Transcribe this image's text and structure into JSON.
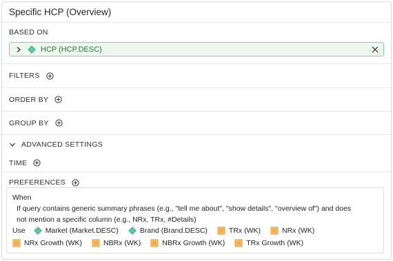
{
  "title": "Specific HCP (Overview)",
  "based_on": {
    "label": "BASED ON",
    "chip": "HCP (HCP.DESC)"
  },
  "sections": {
    "filters": "FILTERS",
    "order_by": "ORDER BY",
    "group_by": "GROUP BY",
    "advanced": "ADVANCED SETTINGS",
    "time": "TIME",
    "preferences": "PREFERENCES"
  },
  "rule": {
    "when": "When",
    "condition_line1": "If query contains generic summary phrases (e.g., \"tell me about\", \"show details\", \"overview of\") and does",
    "condition_line2": "not mention a specific column (e.g., NRx, TRx, #Details)",
    "use": "Use",
    "items": [
      {
        "label": "Market (Market.DESC)",
        "icon": "diamond-icon"
      },
      {
        "label": "Brand (Brand.DESC)",
        "icon": "diamond-icon"
      },
      {
        "label": "TRx (WK)",
        "icon": "measure-icon"
      },
      {
        "label": "NRx (WK)",
        "icon": "measure-icon"
      },
      {
        "label": "NRx Growth (WK)",
        "icon": "measure-icon"
      },
      {
        "label": "NBRx (WK)",
        "icon": "measure-icon"
      },
      {
        "label": "NBRx Growth (WK)",
        "icon": "measure-icon"
      },
      {
        "label": "TRx Growth (WK)",
        "icon": "measure-icon"
      }
    ]
  },
  "colors": {
    "chip_border": "#8fcf9f",
    "chip_bg": "#ecf7ee",
    "dimension_icon": "#5cc8a8",
    "measure_icon": "#e8962e"
  }
}
